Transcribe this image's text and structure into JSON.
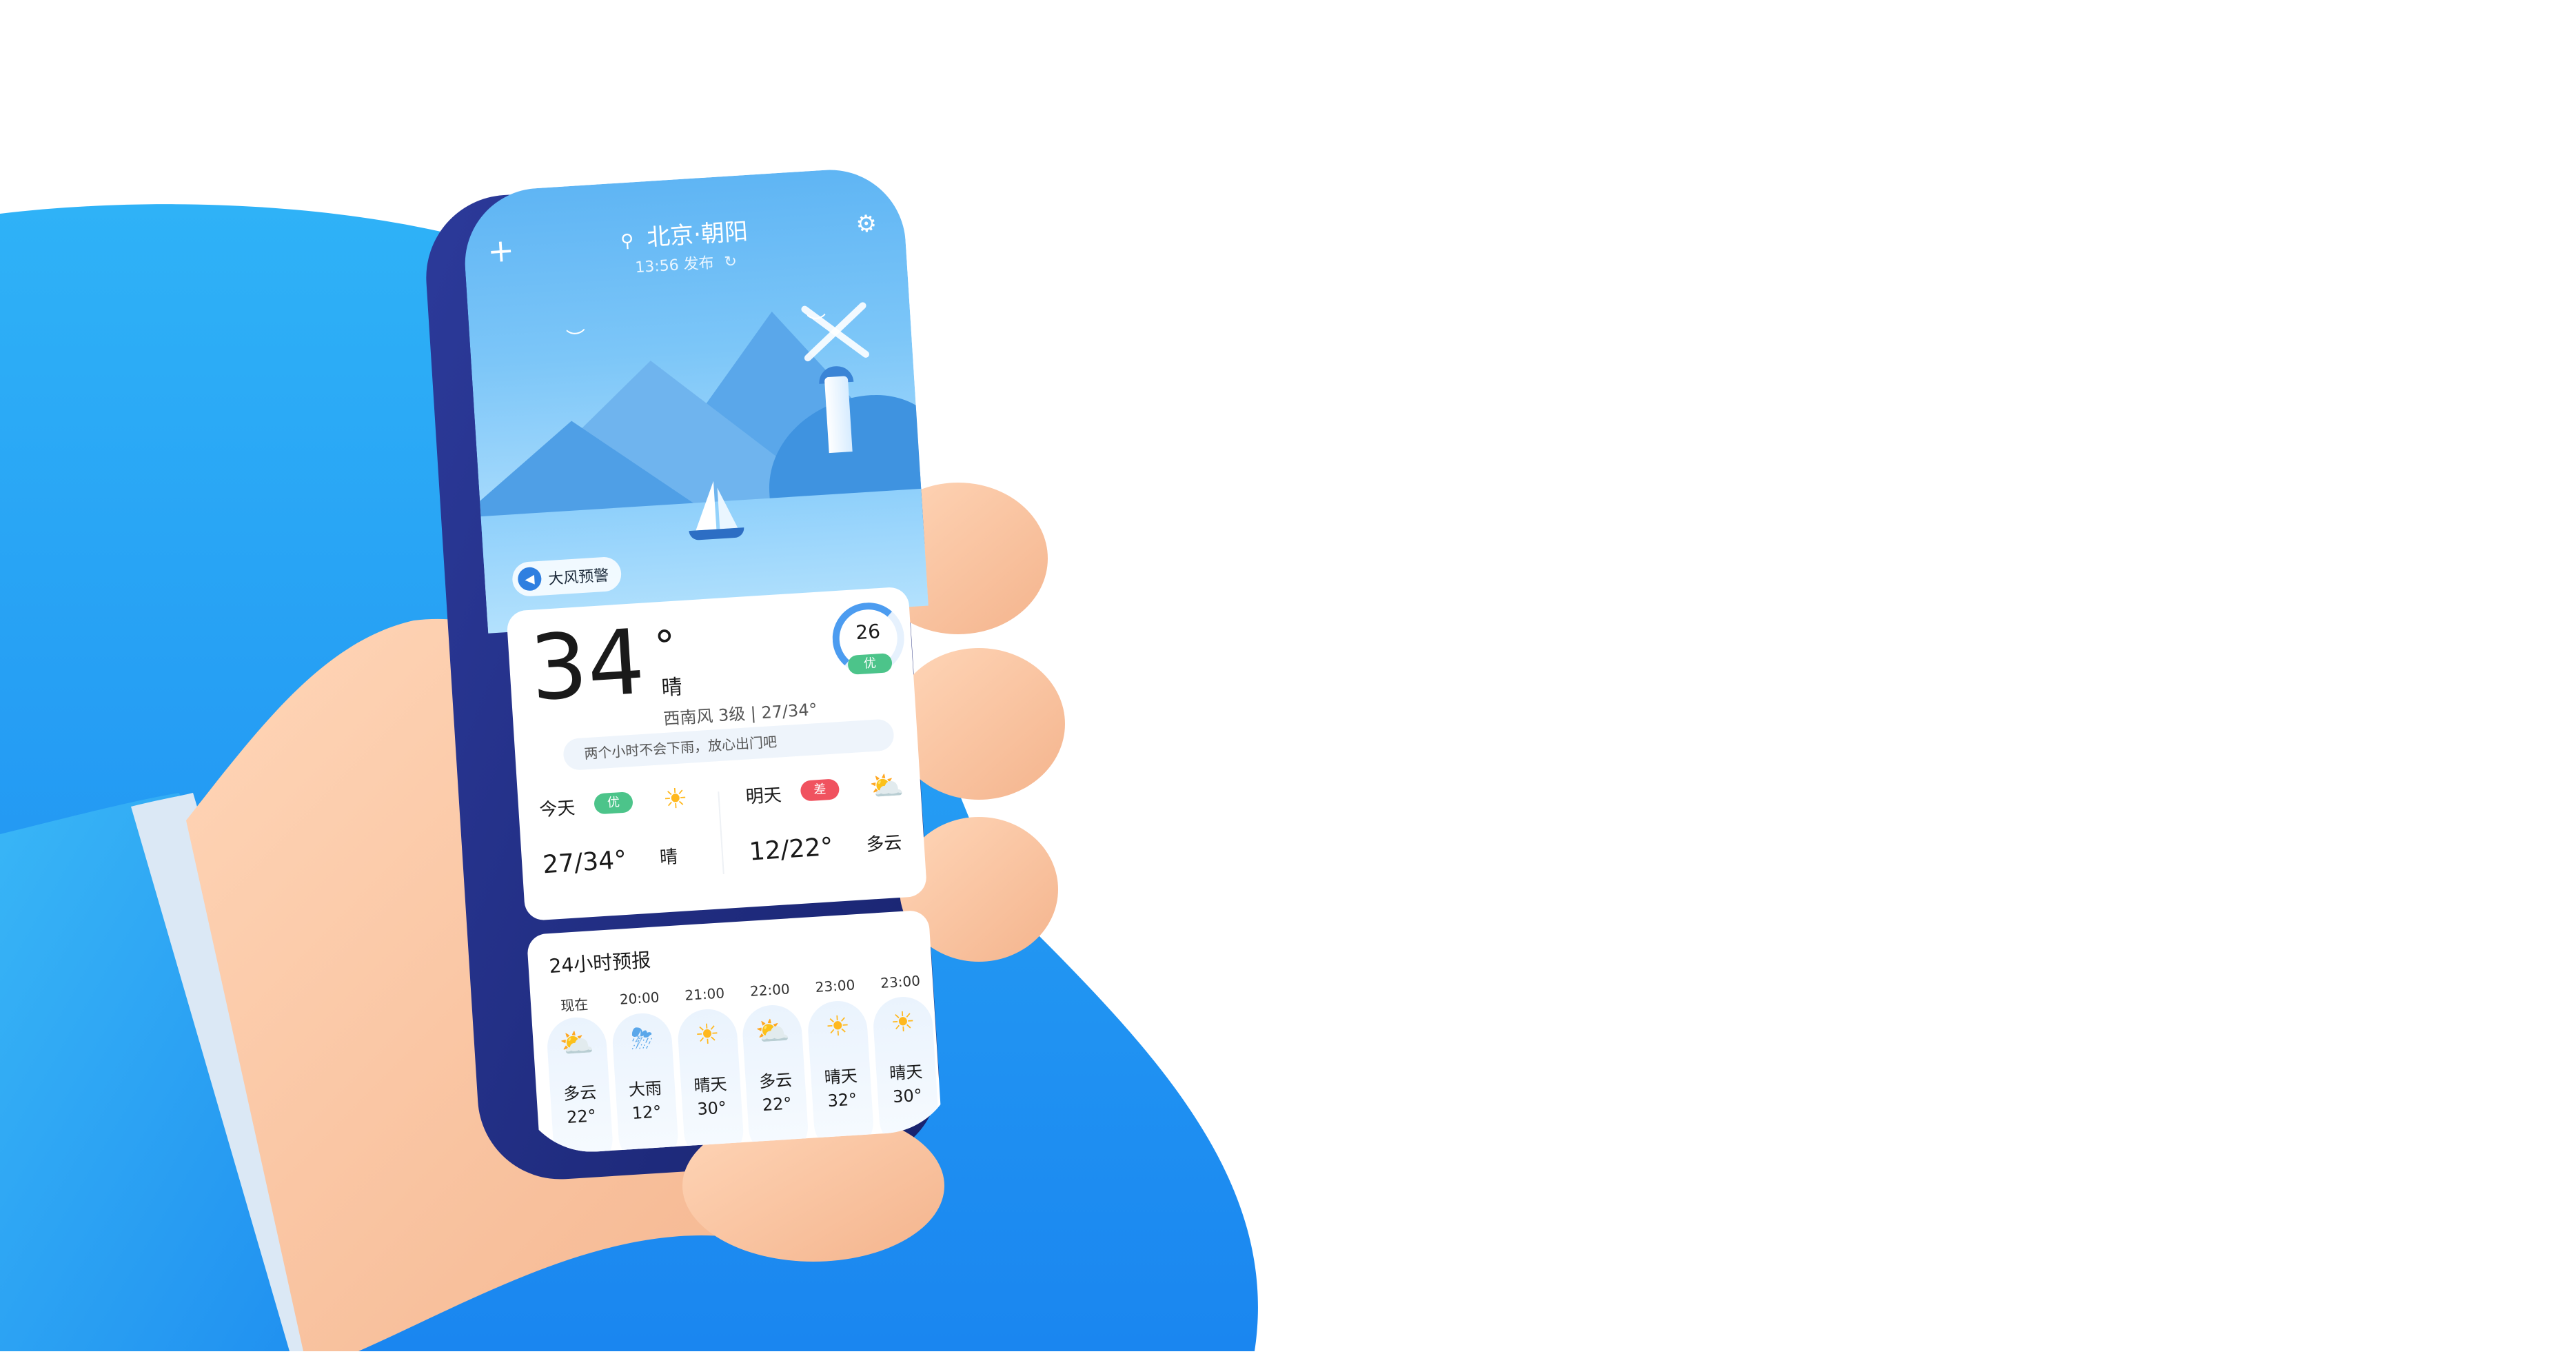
{
  "header": {
    "add_icon": "plus-icon",
    "location_icon": "map-pin-icon",
    "city": "北京·朝阳",
    "published": "13:56 发布",
    "refresh_icon": "refresh-icon",
    "settings_icon": "gear-icon"
  },
  "alert": {
    "icon": "speaker-icon",
    "label": "大风预警"
  },
  "current": {
    "temperature": "34",
    "degree_symbol": "°",
    "condition": "晴",
    "wind_and_range": "西南风 3级 | 27/34°",
    "aqi_value": "26",
    "aqi_level": "优",
    "tip": "两个小时不会下雨，放心出门吧",
    "aqi_color": "#4cc48a"
  },
  "days": [
    {
      "label": "今天",
      "badge": "优",
      "badge_color": "#4cc48a",
      "icon": "sun-icon",
      "glyph": "☀",
      "range": "27/34°",
      "weather": "晴"
    },
    {
      "label": "明天",
      "badge": "差",
      "badge_color": "#f0525f",
      "icon": "partly-cloudy-icon",
      "glyph": "⛅",
      "range": "12/22°",
      "weather": "多云"
    }
  ],
  "forecast": {
    "title": "24小时预报",
    "hours": [
      {
        "time": "现在",
        "icon": "partly-cloudy-icon",
        "glyph": "⛅",
        "weather": "多云",
        "temp": "22°"
      },
      {
        "time": "20:00",
        "icon": "heavy-rain-icon",
        "glyph": "⛈",
        "weather": "大雨",
        "temp": "12°"
      },
      {
        "time": "21:00",
        "icon": "sun-icon",
        "glyph": "☀",
        "weather": "晴天",
        "temp": "30°"
      },
      {
        "time": "22:00",
        "icon": "partly-cloudy-icon",
        "glyph": "⛅",
        "weather": "多云",
        "temp": "22°"
      },
      {
        "time": "23:00",
        "icon": "sun-icon",
        "glyph": "☀",
        "weather": "晴天",
        "temp": "32°"
      },
      {
        "time": "23:00",
        "icon": "sun-icon",
        "glyph": "☀",
        "weather": "晴天",
        "temp": "30°"
      }
    ]
  }
}
